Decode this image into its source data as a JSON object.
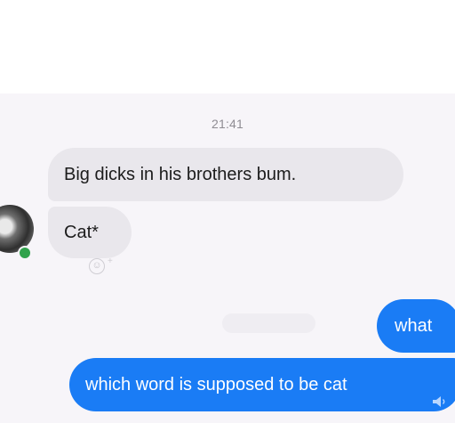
{
  "conversation": {
    "timestamp": "21:41",
    "messages": [
      {
        "sender": "other",
        "text": "Big dicks in his brothers bum."
      },
      {
        "sender": "other",
        "text": "Cat*"
      },
      {
        "sender": "me",
        "text": "what"
      },
      {
        "sender": "me",
        "text": "which word is supposed to be cat"
      }
    ]
  },
  "icons": {
    "avatar": "contact-avatar",
    "reaction": "add-reaction-icon",
    "speaker": "speaker-icon"
  },
  "colors": {
    "outgoing_bubble": "#1a7cf5",
    "incoming_bubble": "#e9e7ec",
    "presence": "#31a24c"
  }
}
